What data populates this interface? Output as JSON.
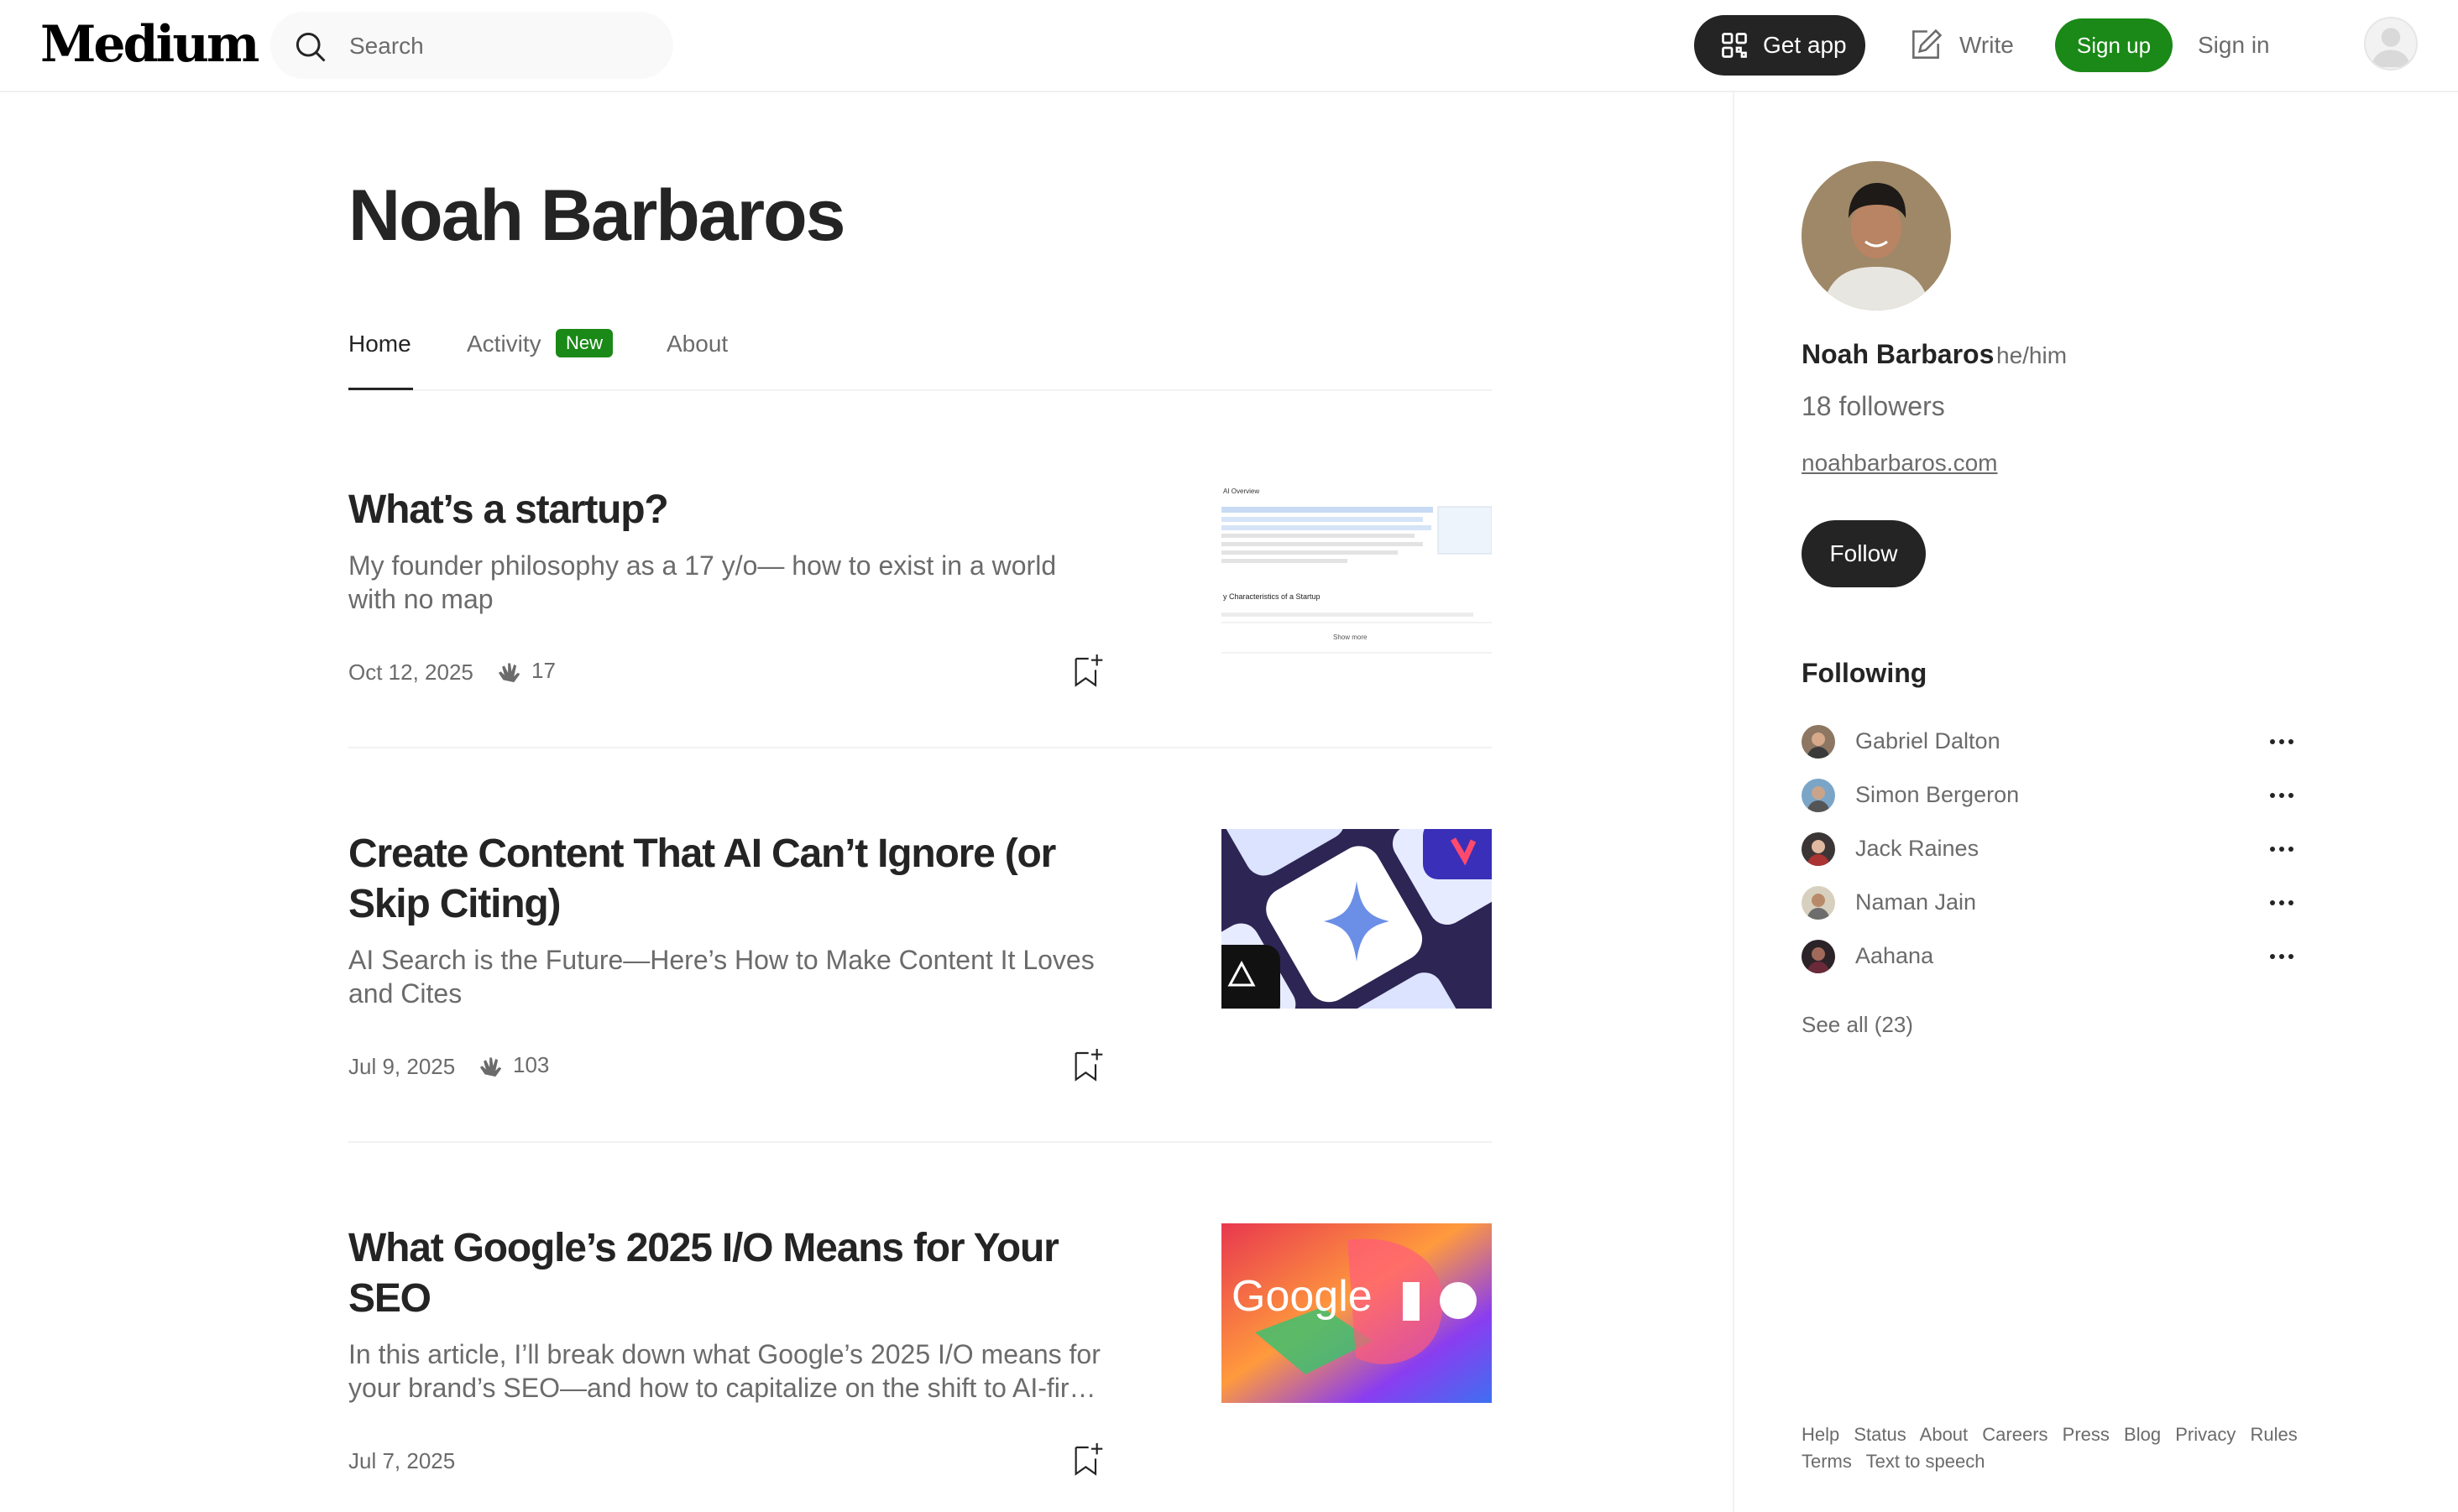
{
  "brand": {
    "logo_text": "Medium",
    "accent_green": "#1a8917",
    "dark": "#242424",
    "muted": "#6b6b6b"
  },
  "header": {
    "search": {
      "placeholder": "Search"
    },
    "get_app_label": "Get app",
    "write_label": "Write",
    "sign_up_label": "Sign up",
    "sign_in_label": "Sign in"
  },
  "profile": {
    "name": "Noah Barbaros",
    "tabs": [
      {
        "label": "Home",
        "active": true
      },
      {
        "label": "Activity",
        "badge": "New"
      },
      {
        "label": "About"
      }
    ]
  },
  "articles": [
    {
      "title": "What’s a startup?",
      "subtitle": "My founder philosophy as a 17 y/o— how to exist in a world with no map",
      "date": "Oct 12, 2025",
      "claps": "17",
      "thumbnail": {
        "heading": "AI Overview",
        "subheading": "y Characteristics of a Startup",
        "button": "Show more"
      }
    },
    {
      "title": "Create Content That AI Can’t Ignore (or Skip Citing)",
      "subtitle": "AI Search is the Future—Here’s How to Make Content It Loves and Cites",
      "date": "Jul 9, 2025",
      "claps": "103"
    },
    {
      "title": "What Google’s 2025 I/O Means for Your SEO",
      "subtitle": "In this article, I’ll break down what Google’s 2025 I/O means for your brand’s SEO—and how to capitalize on the shift to AI-first search.",
      "date": "Jul 7, 2025",
      "claps": "",
      "thumbnail": {
        "logo_text": "Google"
      }
    }
  ],
  "sidebar": {
    "name": "Noah Barbaros",
    "pronouns": "he/him",
    "followers": "18 followers",
    "website": "noahbarbaros.com",
    "follow_label": "Follow",
    "following_title": "Following",
    "following": [
      {
        "name": "Gabriel Dalton"
      },
      {
        "name": "Simon Bergeron"
      },
      {
        "name": "Jack Raines"
      },
      {
        "name": "Naman Jain"
      },
      {
        "name": "Aahana"
      }
    ],
    "see_all": "See all (23)",
    "footer_links": [
      "Help",
      "Status",
      "About",
      "Careers",
      "Press",
      "Blog",
      "Privacy",
      "Rules",
      "Terms",
      "Text to speech"
    ]
  }
}
